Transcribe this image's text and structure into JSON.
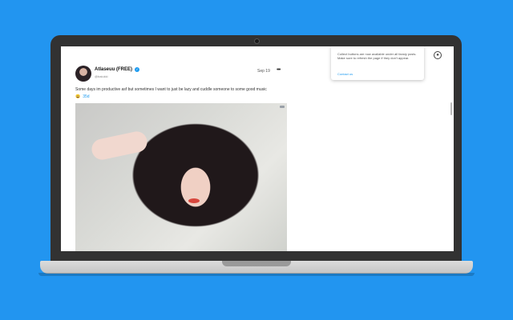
{
  "post": {
    "display_name": "Atlaseuu (FREE)",
    "handle": "@baiukki",
    "date": "Sep 19",
    "more_label": "•••",
    "caption": "Some days im productive asf but sometimes I want to just be lazy and cuddle someone to some good music",
    "emoji": "😀",
    "tag": "35d"
  },
  "popup": {
    "message": "Collect buttons are now available under all fansly posts. Make sure to refresh the page if they don't appear.",
    "link_label": "Contact us"
  },
  "icons": {
    "verified": "verified-badge-icon",
    "more": "more-options-icon",
    "extension": "extension-user-icon"
  },
  "colors": {
    "background": "#2295f0",
    "accent": "#1d9bf0"
  }
}
